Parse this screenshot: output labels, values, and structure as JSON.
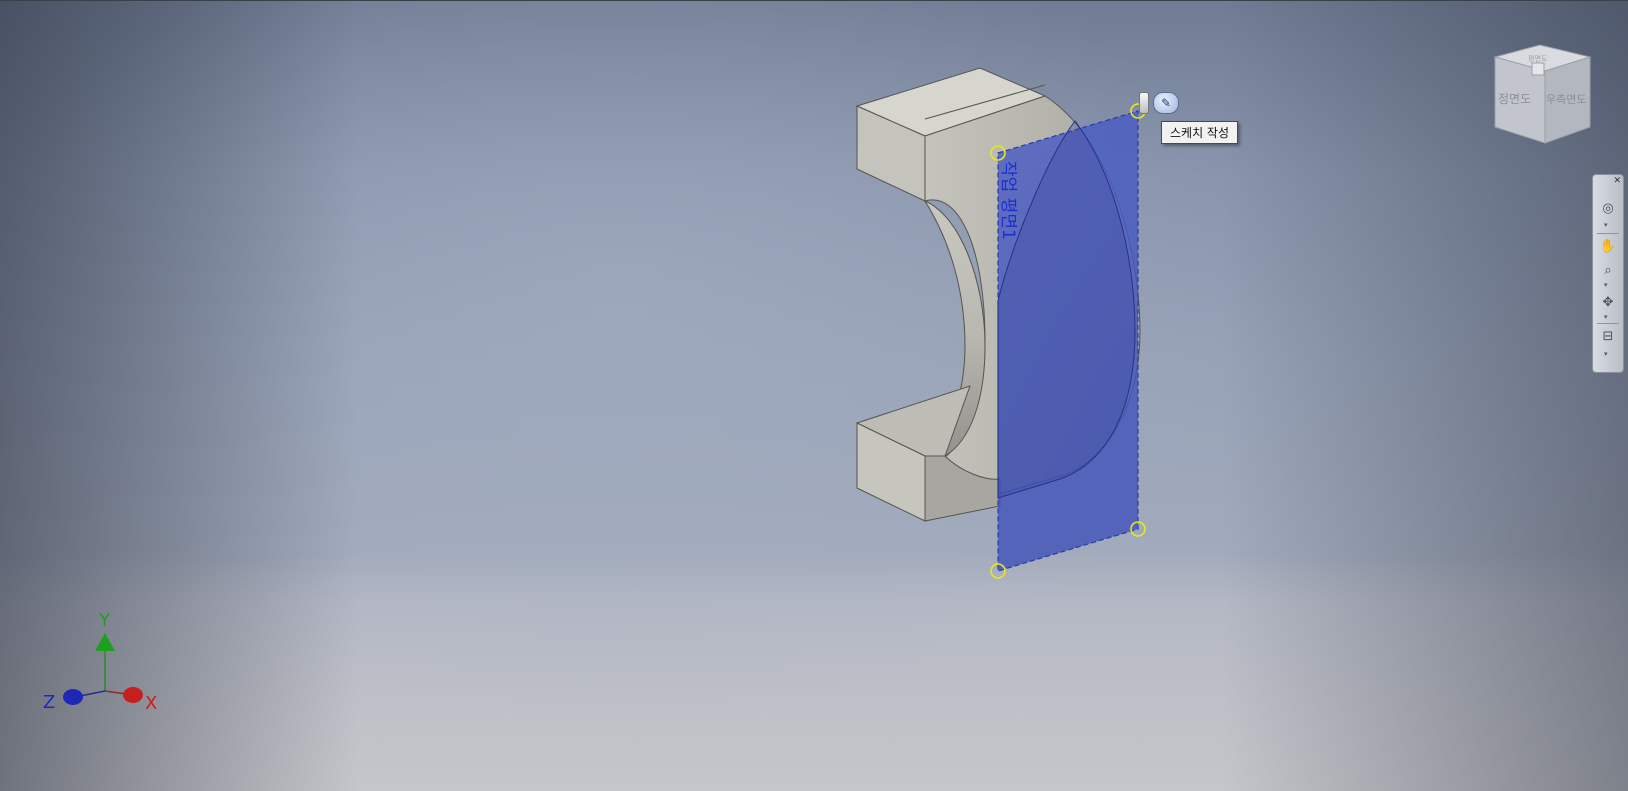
{
  "workplane": {
    "label": "작업 평면1"
  },
  "tooltip": {
    "text": "스케치 작성"
  },
  "mini_toolbar": {
    "sketch_button_icon": "sketch-pencil-icon"
  },
  "view_cube": {
    "front_label": "정면도",
    "right_label": "우측면도",
    "top_label": "평면도"
  },
  "axis_indicator": {
    "x_label": "X",
    "y_label": "Y",
    "z_label": "Z"
  },
  "navigation_bar": {
    "items": [
      "steering-wheel-icon",
      "pan-icon",
      "zoom-icon",
      "orbit-icon",
      "look-at-icon"
    ]
  },
  "colors": {
    "workplane_fill": "#3d4fb8",
    "workplane_border": "#2a3aa8",
    "grip_handles": "#e8e81a",
    "part_face": "#b9b8b0"
  }
}
